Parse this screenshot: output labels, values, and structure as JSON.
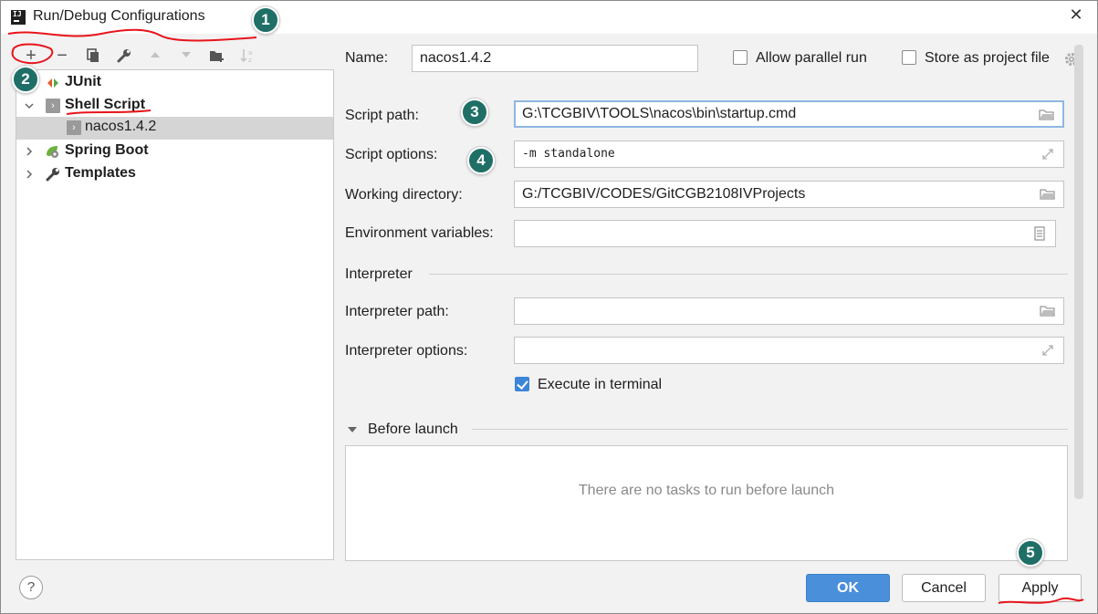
{
  "window": {
    "title": "Run/Debug Configurations",
    "close_glyph": "✕"
  },
  "toolbar": {
    "add_glyph": "+",
    "remove_glyph": "−"
  },
  "tree": {
    "items": [
      {
        "label": "JUnit",
        "icon": "junit-icon",
        "expanded": false
      },
      {
        "label": "Shell Script",
        "icon": "shell-script-icon",
        "expanded": true
      },
      {
        "label": "nacos1.4.2",
        "icon": "shell-script-icon",
        "selected": true
      },
      {
        "label": "Spring Boot",
        "icon": "spring-boot-icon",
        "expanded": false
      },
      {
        "label": "Templates",
        "icon": "wrench-icon",
        "expanded": false
      }
    ]
  },
  "form": {
    "name_label": "Name:",
    "name_value": "nacos1.4.2",
    "allow_parallel_label": "Allow parallel run",
    "allow_parallel_checked": false,
    "store_project_label": "Store as project file",
    "store_project_checked": false,
    "script_path_label": "Script path:",
    "script_path_value": "G:\\TCGBIV\\TOOLS\\nacos\\bin\\startup.cmd",
    "script_options_label": "Script options:",
    "script_options_value": "-m standalone",
    "working_dir_label": "Working directory:",
    "working_dir_value": "G:/TCGBIV/CODES/GitCGB2108IVProjects",
    "env_vars_label": "Environment variables:",
    "env_vars_value": "",
    "interpreter_section": "Interpreter",
    "interpreter_path_label": "Interpreter path:",
    "interpreter_path_value": "",
    "interpreter_options_label": "Interpreter options:",
    "interpreter_options_value": "",
    "execute_terminal_label": "Execute in terminal",
    "execute_terminal_checked": true
  },
  "before_launch": {
    "title": "Before launch",
    "empty_text": "There are no tasks to run before launch"
  },
  "buttons": {
    "help": "?",
    "ok": "OK",
    "cancel": "Cancel",
    "apply": "Apply"
  },
  "annotations": [
    "1",
    "2",
    "3",
    "4",
    "5"
  ],
  "colors": {
    "accent": "#4a8fd9",
    "badge": "#1f6f67",
    "scribble": "#e8141b"
  }
}
